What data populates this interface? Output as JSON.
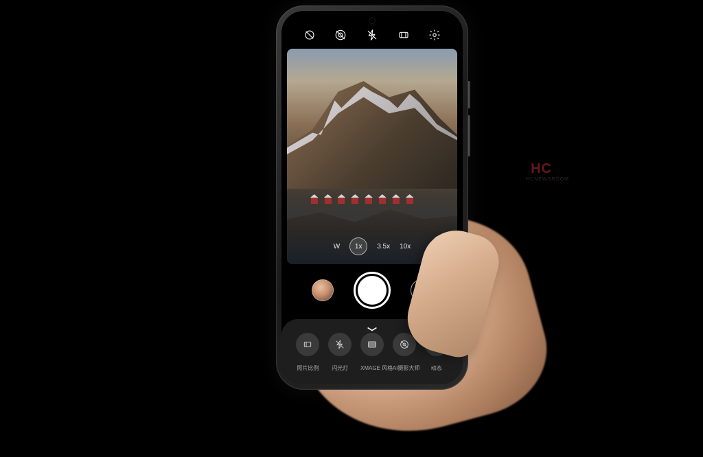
{
  "topIcons": {
    "aiOff": "ai-master-off-icon",
    "filterOff": "filter-off-icon",
    "flashOff": "flash-off-icon",
    "aspectRatio": "aspect-ratio-icon",
    "settings": "settings-icon"
  },
  "zoom": {
    "wide": "W",
    "x1": "1x",
    "x35": "3.5x",
    "x10": "10x",
    "active": "1x"
  },
  "modes": {
    "items": [
      {
        "label": "照片比例",
        "icon": "aspect-icon"
      },
      {
        "label": "闪光灯",
        "icon": "flash-icon"
      },
      {
        "label": "XMAGE 风格",
        "icon": "xmage-icon"
      },
      {
        "label": "AI摄影大师",
        "icon": "ai-icon"
      },
      {
        "label": "动态",
        "icon": "motion-icon"
      }
    ]
  },
  "watermark": {
    "main": "HC",
    "sub": "HCNEWSROOM"
  }
}
